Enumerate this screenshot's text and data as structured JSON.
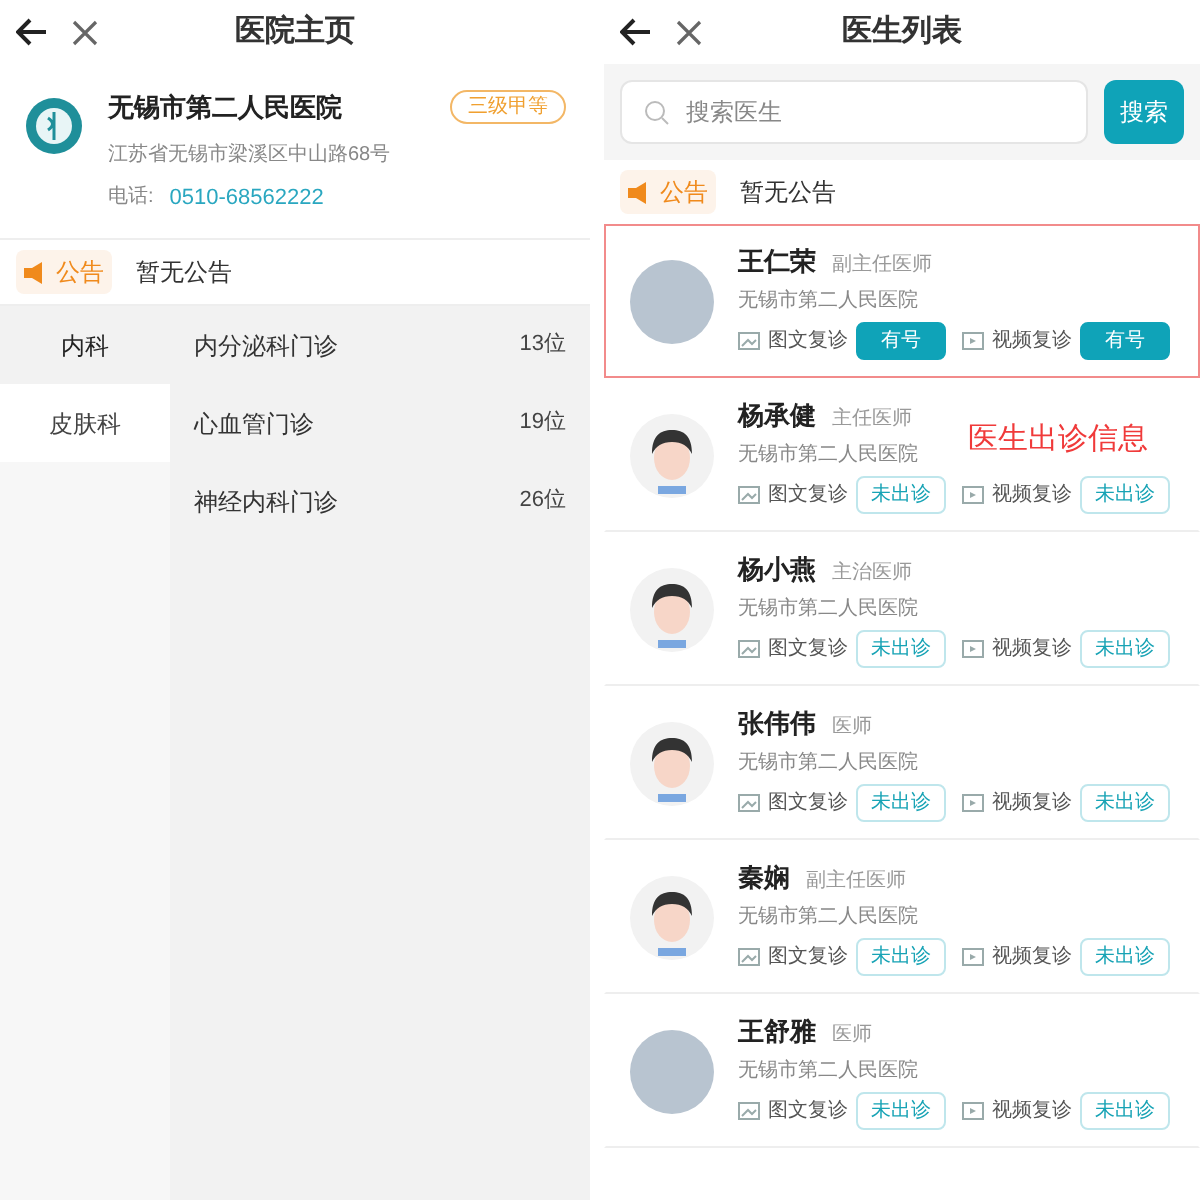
{
  "hospital_page": {
    "title": "医院主页",
    "hospital": {
      "name": "无锡市第二人民医院",
      "grade": "三级甲等",
      "address": "江苏省无锡市梁溪区中山路68号",
      "phone_label": "电话:",
      "phone": "0510-68562222"
    },
    "notice": {
      "tag": "公告",
      "text": "暂无公告"
    },
    "departments": [
      {
        "label": "内科",
        "selected": true
      },
      {
        "label": "皮肤科",
        "selected": false
      }
    ],
    "clinics": [
      {
        "name": "内分泌科门诊",
        "count": "13位"
      },
      {
        "name": "心血管门诊",
        "count": "19位"
      },
      {
        "name": "神经内科门诊",
        "count": "26位"
      }
    ]
  },
  "doctor_list": {
    "title": "医生列表",
    "search": {
      "placeholder": "搜索医生",
      "button": "搜索"
    },
    "notice": {
      "tag": "公告",
      "text": "暂无公告"
    },
    "annotation": "医生出诊信息",
    "doctors": [
      {
        "name": "王仁荣",
        "title": "副主任医师",
        "hospital": "无锡市第二人民医院",
        "avatar": {
          "kind": "photo"
        },
        "highlighted": true,
        "services": [
          {
            "label": "图文复诊",
            "status": "有号",
            "available": true
          },
          {
            "label": "视频复诊",
            "status": "有号",
            "available": true
          }
        ]
      },
      {
        "name": "杨承健",
        "title": "主任医师",
        "hospital": "无锡市第二人民医院",
        "avatar": {
          "kind": "default"
        },
        "highlighted": false,
        "services": [
          {
            "label": "图文复诊",
            "status": "未出诊",
            "available": false
          },
          {
            "label": "视频复诊",
            "status": "未出诊",
            "available": false
          }
        ]
      },
      {
        "name": "杨小燕",
        "title": "主治医师",
        "hospital": "无锡市第二人民医院",
        "avatar": {
          "kind": "default"
        },
        "highlighted": false,
        "services": [
          {
            "label": "图文复诊",
            "status": "未出诊",
            "available": false
          },
          {
            "label": "视频复诊",
            "status": "未出诊",
            "available": false
          }
        ]
      },
      {
        "name": "张伟伟",
        "title": "医师",
        "hospital": "无锡市第二人民医院",
        "avatar": {
          "kind": "default"
        },
        "highlighted": false,
        "services": [
          {
            "label": "图文复诊",
            "status": "未出诊",
            "available": false
          },
          {
            "label": "视频复诊",
            "status": "未出诊",
            "available": false
          }
        ]
      },
      {
        "name": "秦娴",
        "title": "副主任医师",
        "hospital": "无锡市第二人民医院",
        "avatar": {
          "kind": "default"
        },
        "highlighted": false,
        "services": [
          {
            "label": "图文复诊",
            "status": "未出诊",
            "available": false
          },
          {
            "label": "视频复诊",
            "status": "未出诊",
            "available": false
          }
        ]
      },
      {
        "name": "王舒雅",
        "title": "医师",
        "hospital": "无锡市第二人民医院",
        "avatar": {
          "kind": "photo"
        },
        "highlighted": false,
        "services": [
          {
            "label": "图文复诊",
            "status": "未出诊",
            "available": false
          },
          {
            "label": "视频复诊",
            "status": "未出诊",
            "available": false
          }
        ]
      }
    ]
  }
}
